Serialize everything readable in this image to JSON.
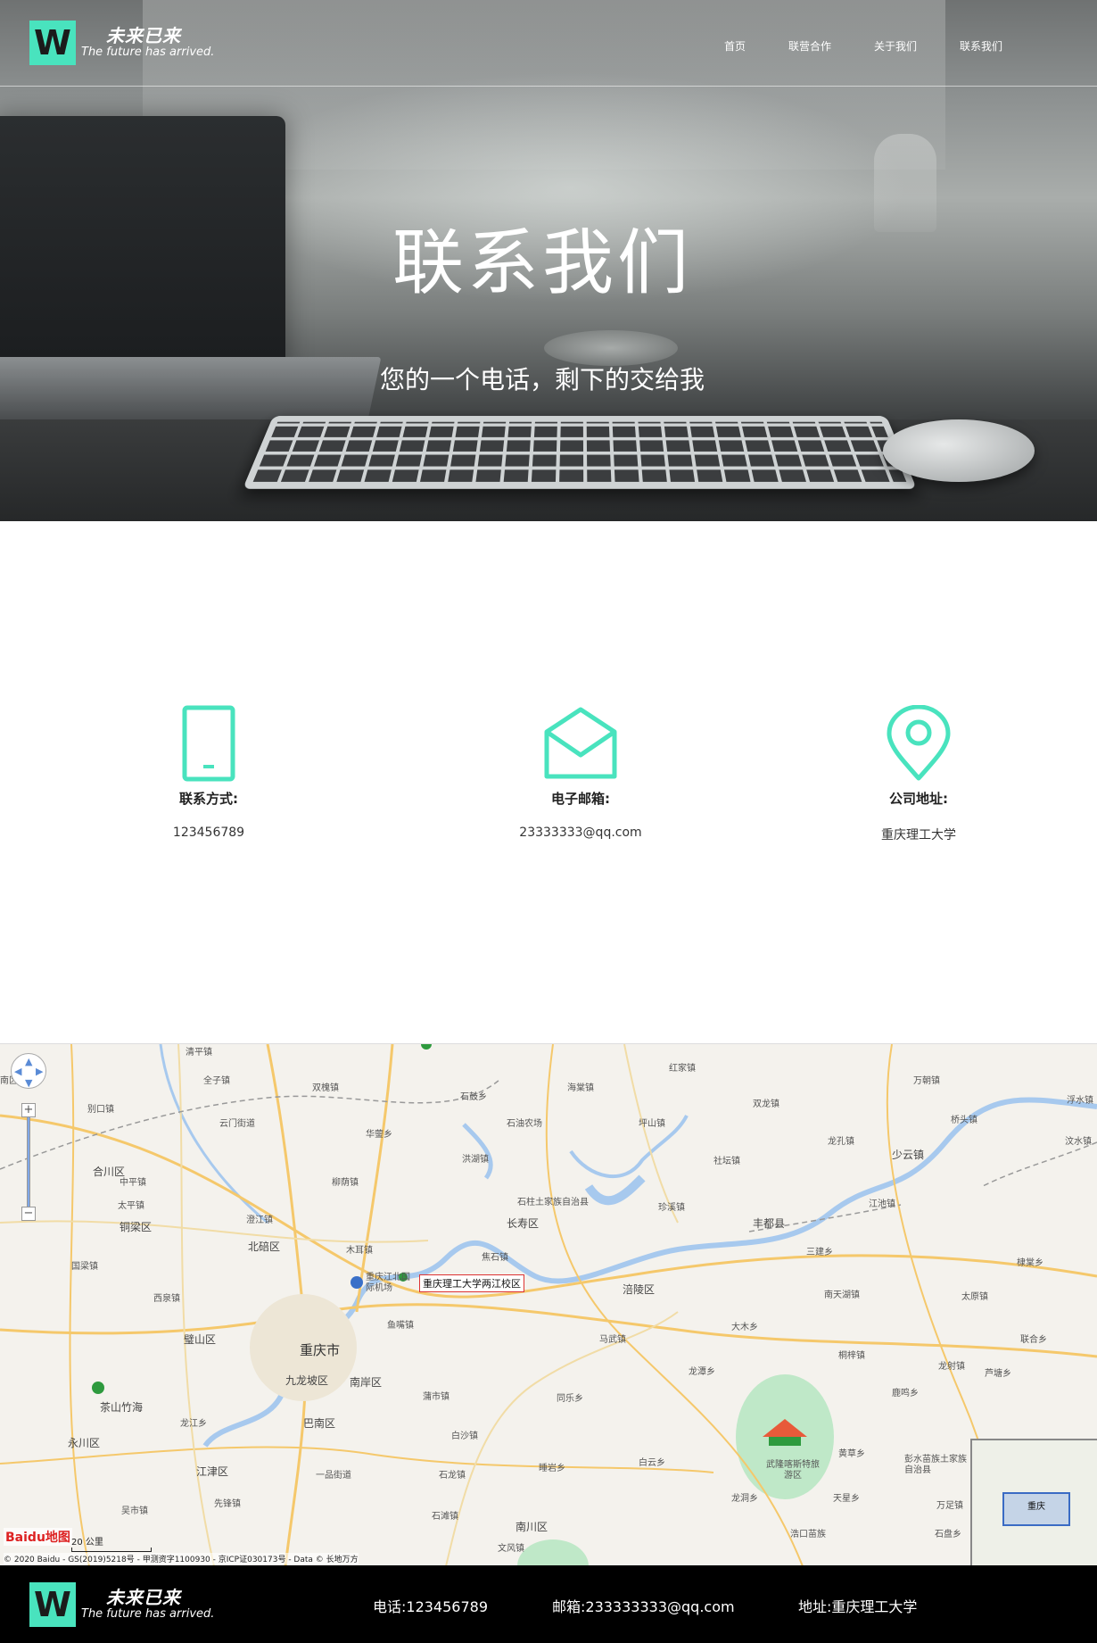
{
  "brand": {
    "logo_letter": "W",
    "name_cn": "未来已来",
    "tagline": "The future has arrived.",
    "accent_color": "#49e3be"
  },
  "nav": {
    "items": [
      {
        "label": "首页"
      },
      {
        "label": "联营合作"
      },
      {
        "label": "关于我们"
      },
      {
        "label": "联系我们"
      }
    ]
  },
  "hero": {
    "title": "联系我们",
    "subtitle": "您的一个电话，剩下的交给我"
  },
  "contact": {
    "items": [
      {
        "icon": "phone-icon",
        "label": "联系方式:",
        "value": "123456789"
      },
      {
        "icon": "mail-icon",
        "label": "电子邮箱:",
        "value": "23333333@qq.com"
      },
      {
        "icon": "location-pin-icon",
        "label": "公司地址:",
        "value": "重庆理工大学"
      }
    ]
  },
  "map": {
    "marker_label": "重庆理工大学两江校区",
    "city": "重庆市",
    "places": [
      "清平镇",
      "全子镇",
      "双槐镇",
      "石鼓乡",
      "海棠镇",
      "红家镇",
      "双龙镇",
      "万朝镇",
      "浮水镇",
      "桥头镇",
      "南区",
      "别口镇",
      "云门街道",
      "华蓥乡",
      "石油农场",
      "洪湖镇",
      "中平镇",
      "坪山镇",
      "社坛镇",
      "龙孔镇",
      "少云镇",
      "合川区",
      "柳荫镇",
      "石柱土家族自治县",
      "太平镇",
      "铜梁区",
      "澄江镇",
      "长寿区",
      "珍溪镇",
      "丰都县",
      "三建乡",
      "北碚区",
      "木耳镇",
      "重庆江北国际机场",
      "焦石镇",
      "涪陵区",
      "南天湖镇",
      "太原镇",
      "国梁镇",
      "西泉镇",
      "鱼嘴镇",
      "马武镇",
      "大木乡",
      "桐梓镇",
      "璧山区",
      "九龙坡区",
      "南岸区",
      "同乐乡",
      "龙潭乡",
      "龙射镇",
      "茶山竹海",
      "龙江乡",
      "巴南区",
      "蒲市镇",
      "白沙镇",
      "武隆喀斯特旅游区",
      "黄草乡",
      "彭水苗族土家族自治县",
      "永川区",
      "江津区",
      "一品街道",
      "石龙镇",
      "睡岩乡",
      "白云乡",
      "龙洞乡",
      "天星乡",
      "先锋镇",
      "吴市镇",
      "石滩镇",
      "南川区",
      "文风镇",
      "浩口苗族",
      "万足镇",
      "石盘乡",
      "江池镇",
      "鹿鸣乡",
      "芦塘乡",
      "联合乡",
      "棣棠乡",
      "汶水镇"
    ],
    "overview_label": "重庆",
    "scale_label": "20 公里",
    "baidu_logo": "Baidu地图",
    "copyright": "© 2020 Baidu - GS(2019)5218号 - 甲测资字1100930 - 京ICP证030173号 - Data © 长地万方"
  },
  "footer": {
    "phone": "电话:123456789",
    "email": "邮箱:233333333@qq.com",
    "address": "地址:重庆理工大学"
  }
}
